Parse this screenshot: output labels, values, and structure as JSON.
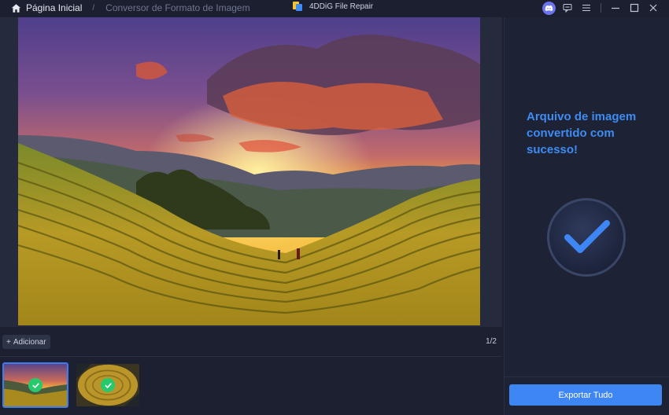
{
  "titlebar": {
    "home_label": "Página Inicial",
    "separator": "/",
    "current_page": "Conversor de Formato de Imagem",
    "app_name": "4DDiG File Repair"
  },
  "preview": {
    "image_subject": "rice-terraces-sunset"
  },
  "toolbar": {
    "add_label": "Adicionar",
    "add_icon": "+",
    "page_indicator": "1/2"
  },
  "thumbnails": [
    {
      "subject": "rice-terraces-sunset",
      "selected": true,
      "status": "converted"
    },
    {
      "subject": "round-golden-field",
      "selected": false,
      "status": "converted"
    }
  ],
  "panel": {
    "success_message": "Arquivo de imagem convertido com sucesso!",
    "export_label": "Exportar Tudo"
  },
  "colors": {
    "accent": "#3e86f4",
    "success_text": "#3e8cf3",
    "check_green": "#28c86c",
    "background": "#1b1f30"
  }
}
